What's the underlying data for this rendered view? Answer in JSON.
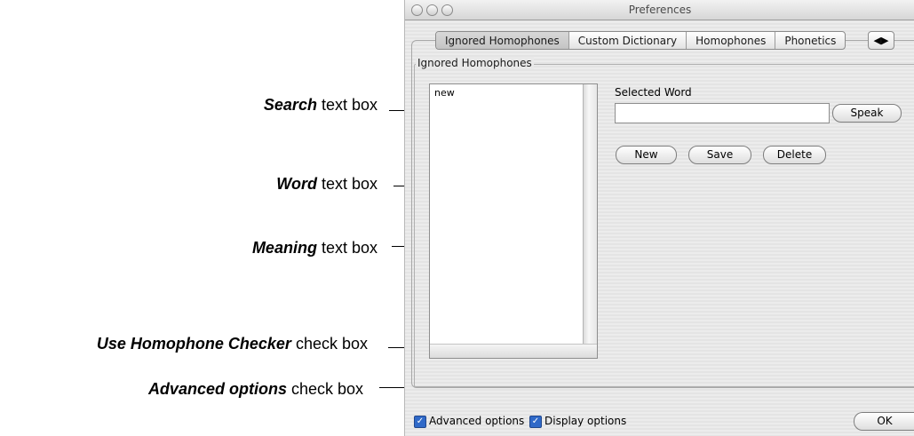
{
  "window": {
    "title": "Preferences",
    "tabs": [
      "Ignored Homophones",
      "Custom Dictionary",
      "Homophones",
      "Phonetics"
    ],
    "tab_scroll_glyph": "◀▶",
    "group_label": "Ignored Homophones",
    "list_items": [
      "new"
    ],
    "selected_word_label": "Selected Word",
    "selected_word_value": "",
    "speak_label": "Speak",
    "new_label": "New",
    "save_label": "Save",
    "delete_label": "Delete",
    "advanced_options_label": "Advanced options",
    "display_options_label": "Display options",
    "ok_label": "OK",
    "advanced_options_checked": true,
    "display_options_checked": true
  },
  "callouts": [
    {
      "bold": "Search",
      "rest": " text box"
    },
    {
      "bold": "Word",
      "rest": " text box"
    },
    {
      "bold": "Meaning",
      "rest": " text box"
    },
    {
      "bold": "Use Homophone Checker",
      "rest": " check box"
    },
    {
      "bold": "Advanced options",
      "rest": " check box"
    }
  ],
  "accent_color": "#2f69c8"
}
